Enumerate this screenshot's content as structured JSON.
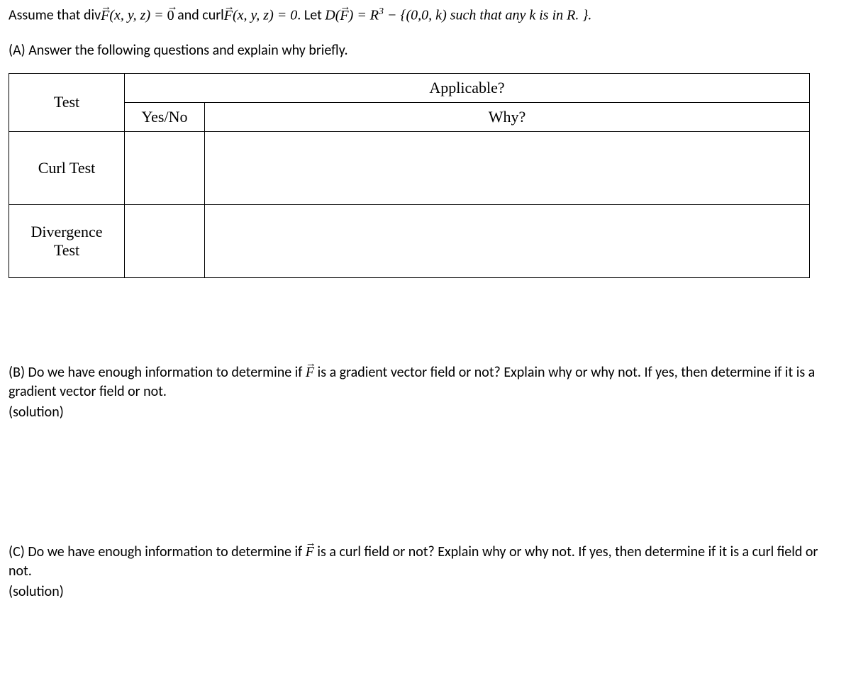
{
  "intro": {
    "assume_prefix": "Assume that div",
    "vec_F": "F",
    "args": "(x, y, z) = ",
    "zero_vec": "0",
    "and_curl": " and curl",
    "eq_zero": " = 0. Let ",
    "D_of": "D",
    "F_paren_open": "(",
    "F_paren_close": ")",
    "eq_R3": " = R",
    "exp3": "3",
    "minus_set": " − {(0,0, k) such that any k is in R. }.",
    "partA": "(A) Answer the following questions and explain why briefly."
  },
  "table": {
    "test_label": "Test",
    "applicable": "Applicable?",
    "yesno": "Yes/No",
    "why": "Why?",
    "rows": [
      {
        "name": "Curl Test",
        "yn": "",
        "why": ""
      },
      {
        "name": "Divergence Test",
        "yn": "",
        "why": ""
      }
    ]
  },
  "partB": {
    "prefix": "(B) Do we have enough information to determine if ",
    "suffix": " is a gradient vector field or not? Explain why or why not. If yes, then determine if it is a gradient vector field or not.",
    "solution": "(solution)"
  },
  "partC": {
    "prefix": "(C) Do we have enough information to determine if ",
    "suffix": " is a curl field or not? Explain why or why not. If yes, then determine if it is a curl field or not.",
    "solution": "(solution)"
  }
}
